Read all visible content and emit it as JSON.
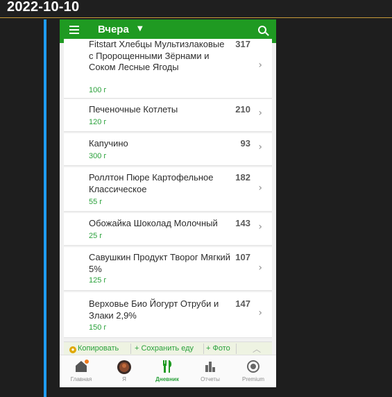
{
  "date": "2022-10-10",
  "appbar": {
    "title": "Вчера"
  },
  "items": [
    {
      "name": "Fitstart Хлебцы Мультизлаковые с Пророщенными Зёрнами и Соком Лесные Ягоды",
      "cal": "317",
      "weight": "100 г"
    },
    {
      "name": "Печеночные Котлеты",
      "cal": "210",
      "weight": "120 г"
    },
    {
      "name": "Капучино",
      "cal": "93",
      "weight": "300 г"
    },
    {
      "name": "Роллтон Пюре Картофельное Классическое",
      "cal": "182",
      "weight": "55 г"
    },
    {
      "name": "Обожайка Шоколад Молочный",
      "cal": "143",
      "weight": "25 г"
    },
    {
      "name": "Савушкин Продукт Творог Мягкий 5%",
      "cal": "107",
      "weight": "125 г"
    },
    {
      "name": "Верховье Био Йогурт Отруби и Злаки 2,9%",
      "cal": "147",
      "weight": "150 г"
    }
  ],
  "actions": {
    "copy": "Копировать",
    "save": "+ Сохранить еду",
    "photo": "+ Фото"
  },
  "nav": {
    "home": "Главная",
    "me": "Я",
    "diary": "Дневник",
    "reports": "Отчеты",
    "premium": "Premium"
  },
  "colors": {
    "accent_green": "#1f9a22",
    "weight_green": "#2aa13b",
    "side_bar": "#1f9cf0",
    "header_line": "#c89a3a"
  }
}
